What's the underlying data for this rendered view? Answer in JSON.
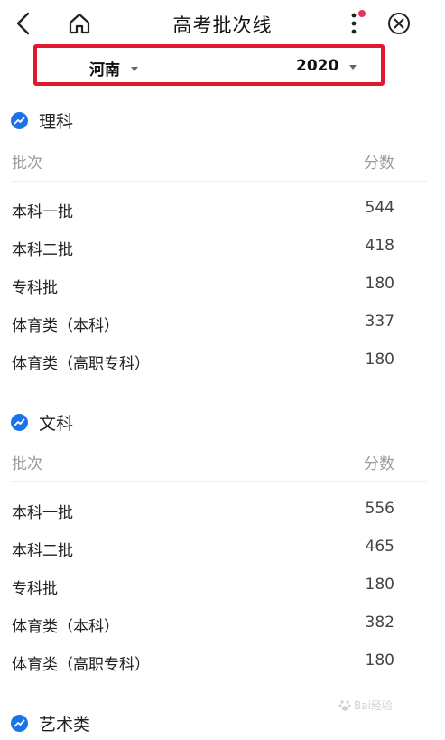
{
  "header": {
    "title": "高考批次线"
  },
  "filter": {
    "province": "河南",
    "year": "2020"
  },
  "sections": [
    {
      "name": "理科",
      "col_batch": "批次",
      "col_score": "分数",
      "rows": [
        {
          "batch": "本科一批",
          "score": "544"
        },
        {
          "batch": "本科二批",
          "score": "418"
        },
        {
          "batch": "专科批",
          "score": "180"
        },
        {
          "batch": "体育类（本科）",
          "score": "337"
        },
        {
          "batch": "体育类（高职专科）",
          "score": "180"
        }
      ]
    },
    {
      "name": "文科",
      "col_batch": "批次",
      "col_score": "分数",
      "rows": [
        {
          "batch": "本科一批",
          "score": "556"
        },
        {
          "batch": "本科二批",
          "score": "465"
        },
        {
          "batch": "专科批",
          "score": "180"
        },
        {
          "batch": "体育类（本科）",
          "score": "382"
        },
        {
          "batch": "体育类（高职专科）",
          "score": "180"
        }
      ]
    },
    {
      "name": "艺术类"
    }
  ],
  "watermark": {
    "text": "Bai经验"
  },
  "colors": {
    "accent": "#1a73e8",
    "highlight_border": "#e01830",
    "notify_dot": "#e8335c"
  }
}
